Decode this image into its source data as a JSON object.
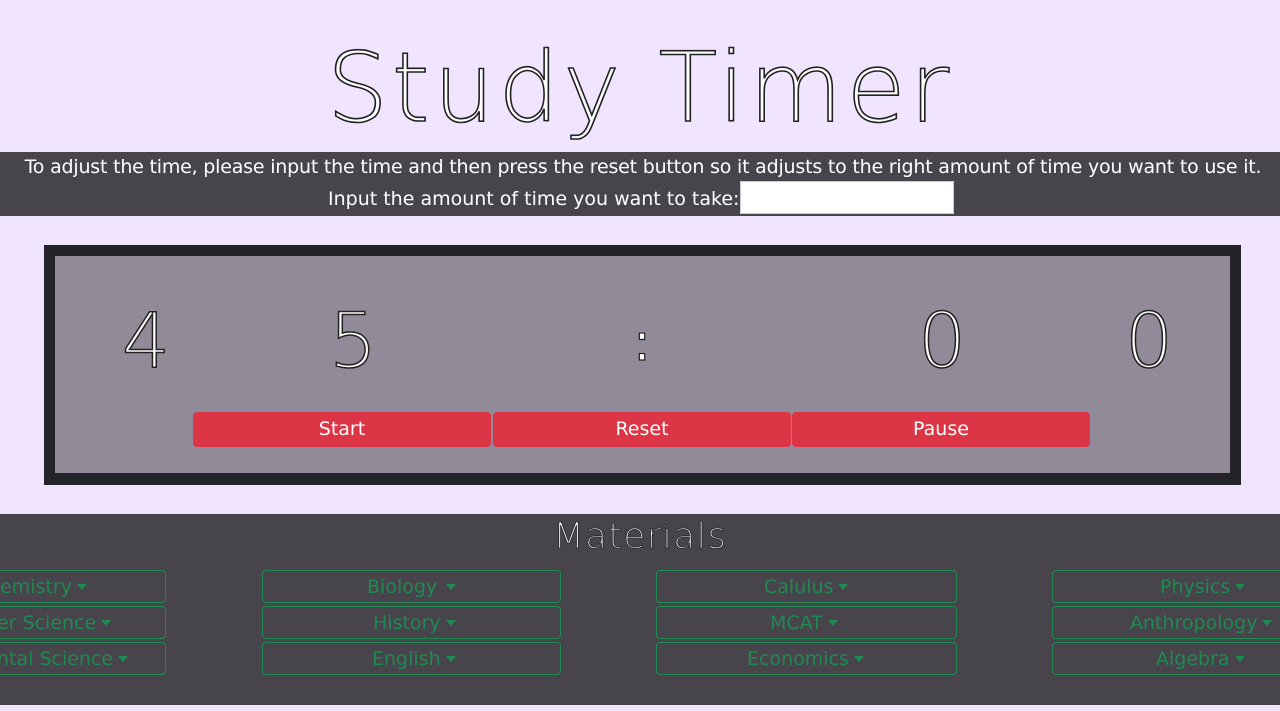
{
  "title": "Study Timer",
  "info": {
    "instruction": "To adjust the time, please input the time and then press the reset button so it adjusts to the right amount of time you want to use it.",
    "input_label": "Input the amount of time you want to take:",
    "input_value": "",
    "input_placeholder": ""
  },
  "timer": {
    "minutes_tens": "4",
    "minutes_ones": "5",
    "separator": ":",
    "seconds_tens": "0",
    "seconds_ones": "0",
    "buttons": {
      "start": "Start",
      "reset": "Reset",
      "pause": "Pause"
    }
  },
  "materials": {
    "title": "Materials",
    "columns": [
      [
        "emistry",
        "er Science",
        "ntal Science"
      ],
      [
        "Biology",
        "History",
        "English"
      ],
      [
        "Calulus",
        "MCAT",
        "Economics"
      ],
      [
        "Physics",
        "Anthropology",
        "Algebra"
      ]
    ]
  },
  "colors": {
    "background": "#f0e4ff",
    "band": "#47444b",
    "timer_frame": "#24232a",
    "timer_panel": "#938a99",
    "button": "#dc3545",
    "dropdown_accent": "#1e8a52"
  }
}
